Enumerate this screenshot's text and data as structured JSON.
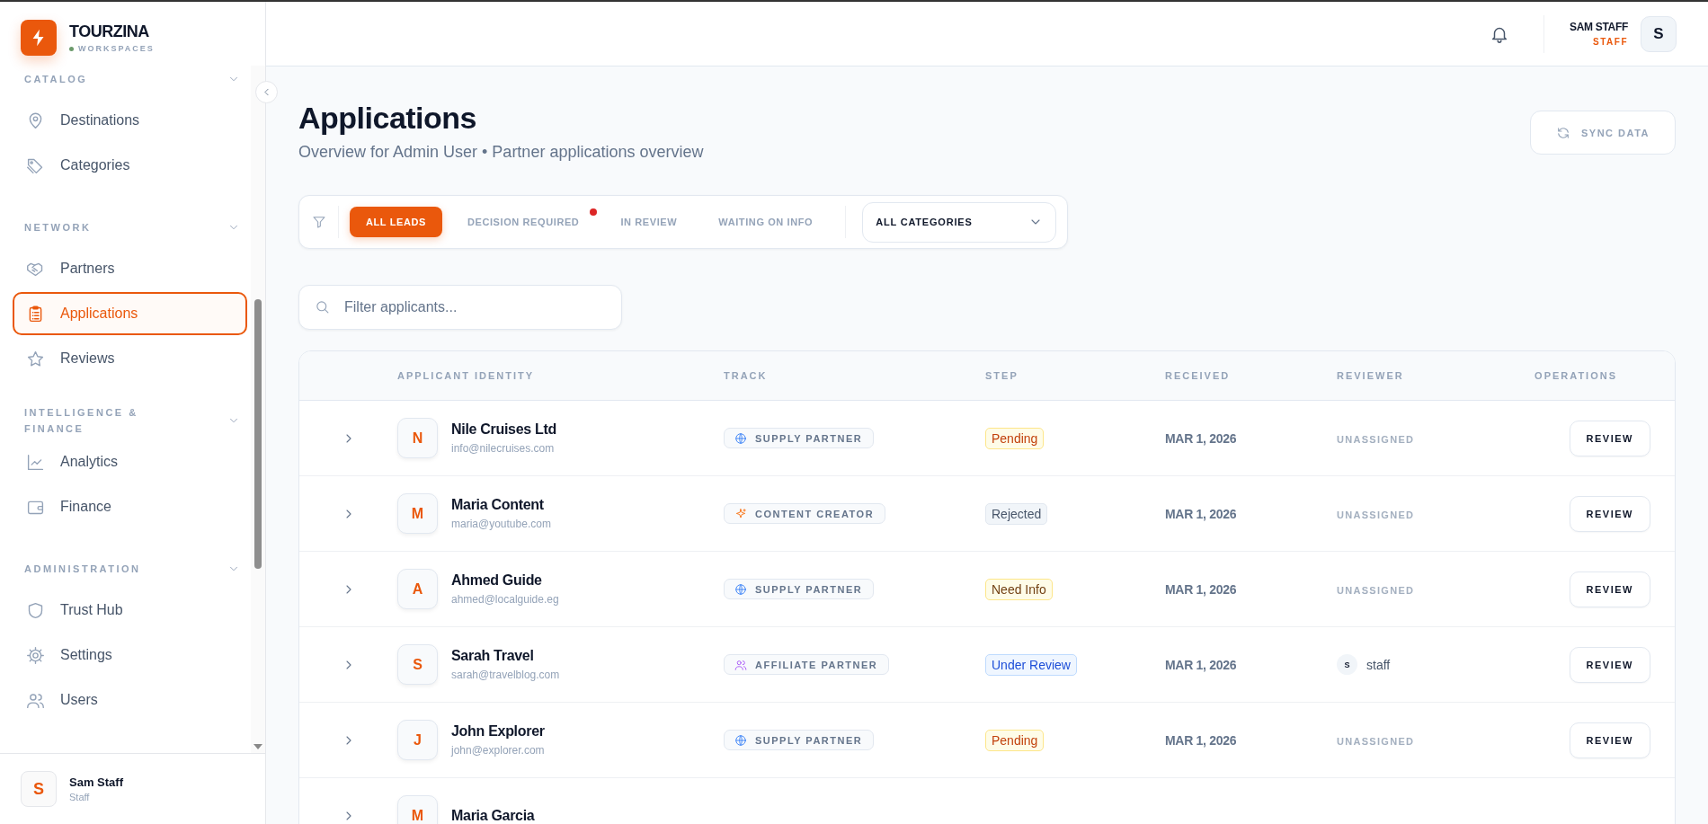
{
  "brand": {
    "name": "TOURZINA",
    "subtitle": "WORKSPACES"
  },
  "sidebar": {
    "sections": [
      {
        "title": "CATALOG",
        "items": [
          {
            "label": "Destinations",
            "selected": false
          },
          {
            "label": "Categories",
            "selected": false
          }
        ]
      },
      {
        "title": "NETWORK",
        "items": [
          {
            "label": "Partners",
            "selected": false
          },
          {
            "label": "Applications",
            "selected": true
          },
          {
            "label": "Reviews",
            "selected": false
          }
        ]
      },
      {
        "title": "INTELLIGENCE & FINANCE",
        "items": [
          {
            "label": "Analytics",
            "selected": false
          },
          {
            "label": "Finance",
            "selected": false
          }
        ]
      },
      {
        "title": "ADMINISTRATION",
        "items": [
          {
            "label": "Trust Hub",
            "selected": false
          },
          {
            "label": "Settings",
            "selected": false
          },
          {
            "label": "Users",
            "selected": false
          }
        ]
      }
    ]
  },
  "sidebar_user": {
    "initial": "S",
    "name": "Sam Staff",
    "role": "Staff"
  },
  "header": {
    "user_name": "SAM STAFF",
    "user_role": "STAFF",
    "avatar": "S"
  },
  "page": {
    "title": "Applications",
    "subtitle": "Overview for Admin User • Partner applications overview",
    "sync_button": "SYNC DATA"
  },
  "filters": {
    "tabs": [
      {
        "label": "ALL LEADS",
        "selected": true,
        "alert": false
      },
      {
        "label": "DECISION REQUIRED",
        "selected": false,
        "alert": true
      },
      {
        "label": "IN REVIEW",
        "selected": false,
        "alert": false
      },
      {
        "label": "WAITING ON INFO",
        "selected": false,
        "alert": false
      }
    ],
    "category": "ALL CATEGORIES"
  },
  "search": {
    "placeholder": "Filter applicants..."
  },
  "table": {
    "columns": [
      "APPLICANT IDENTITY",
      "TRACK",
      "STEP",
      "RECEIVED",
      "REVIEWER",
      "OPERATIONS"
    ],
    "rows": [
      {
        "initial": "N",
        "name": "Nile Cruises Ltd",
        "email": "info@nilecruises.com",
        "track": {
          "kind": "supply",
          "label": "SUPPLY PARTNER"
        },
        "step": {
          "kind": "pending",
          "label": "Pending"
        },
        "received": "MAR 1, 2026",
        "reviewer": {
          "kind": "unassigned",
          "label": "UNASSIGNED"
        },
        "action": "REVIEW"
      },
      {
        "initial": "M",
        "name": "Maria Content",
        "email": "maria@youtube.com",
        "track": {
          "kind": "creator",
          "label": "CONTENT CREATOR"
        },
        "step": {
          "kind": "rejected",
          "label": "Rejected"
        },
        "received": "MAR 1, 2026",
        "reviewer": {
          "kind": "unassigned",
          "label": "UNASSIGNED"
        },
        "action": "REVIEW"
      },
      {
        "initial": "A",
        "name": "Ahmed Guide",
        "email": "ahmed@localguide.eg",
        "track": {
          "kind": "supply",
          "label": "SUPPLY PARTNER"
        },
        "step": {
          "kind": "need_info",
          "label": "Need Info"
        },
        "received": "MAR 1, 2026",
        "reviewer": {
          "kind": "unassigned",
          "label": "UNASSIGNED"
        },
        "action": "REVIEW"
      },
      {
        "initial": "S",
        "name": "Sarah Travel",
        "email": "sarah@travelblog.com",
        "track": {
          "kind": "affiliate",
          "label": "AFFILIATE PARTNER"
        },
        "step": {
          "kind": "under_review",
          "label": "Under Review"
        },
        "received": "MAR 1, 2026",
        "reviewer": {
          "kind": "person",
          "initial": "S",
          "name": "staff"
        },
        "action": "REVIEW"
      },
      {
        "initial": "J",
        "name": "John Explorer",
        "email": "john@explorer.com",
        "track": {
          "kind": "supply",
          "label": "SUPPLY PARTNER"
        },
        "step": {
          "kind": "pending",
          "label": "Pending"
        },
        "received": "MAR 1, 2026",
        "reviewer": {
          "kind": "unassigned",
          "label": "UNASSIGNED"
        },
        "action": "REVIEW"
      },
      {
        "initial": "M",
        "name": "Maria Garcia"
      }
    ]
  }
}
